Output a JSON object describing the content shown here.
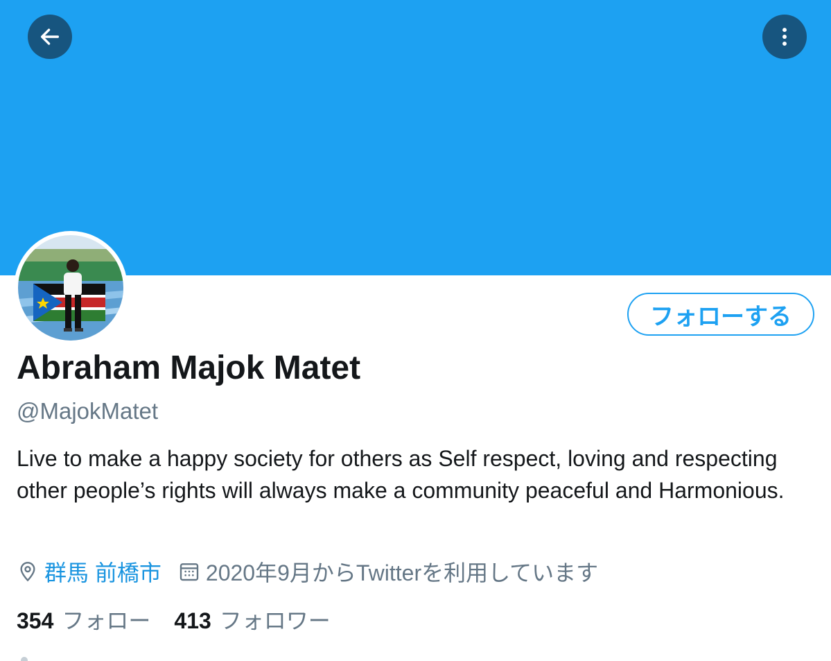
{
  "profile": {
    "name": "Abraham Majok Matet",
    "handle": "@MajokMatet",
    "bio": "Live to make a happy society for others as Self respect, loving and respecting other people’s rights will always make a community peaceful and Harmonious.",
    "location": "群馬 前橋市",
    "joined": "2020年9月からTwitterを利用しています"
  },
  "actions": {
    "follow_label": "フォローする"
  },
  "stats": {
    "following_count": "354",
    "following_label": "フォロー",
    "followers_count": "413",
    "followers_label": "フォロワー"
  },
  "icons": {
    "back": "arrow-left-icon",
    "more": "more-vertical-icon",
    "location": "location-pin-icon",
    "calendar": "calendar-icon"
  },
  "colors": {
    "banner": "#1da1f2",
    "accent": "#1da1f2",
    "link": "#1b95e0",
    "overlay_button": "#17557f",
    "text_primary": "#14171a",
    "text_secondary": "#657786"
  }
}
